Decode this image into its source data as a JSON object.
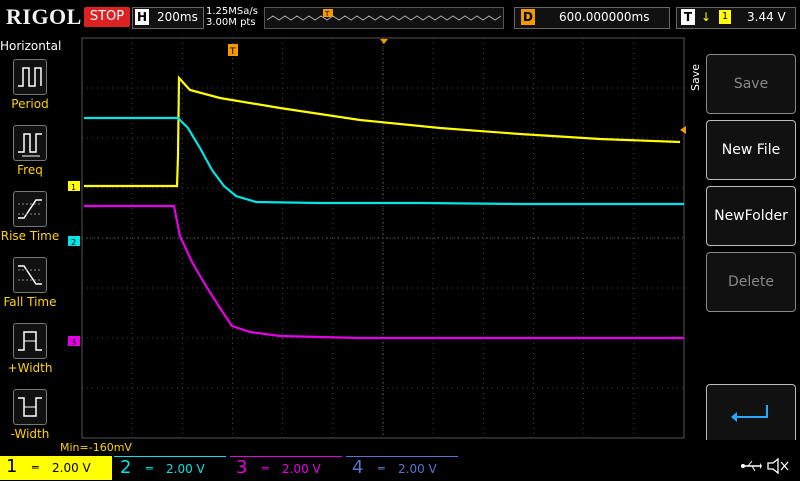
{
  "top": {
    "brand": "RIGOL",
    "run_state": "STOP",
    "timebase_label": "H",
    "timebase": "200ms",
    "sample_rate": "1.25MSa/s",
    "mem_depth": "3.00M pts",
    "delay_label": "D",
    "delay": "600.000000ms",
    "trig_label": "T",
    "trig_source": "1",
    "trig_level": "3.44 V"
  },
  "left_menu": {
    "title": "Horizontal",
    "items": [
      {
        "label": "Period",
        "icon": "period-icon"
      },
      {
        "label": "Freq",
        "icon": "freq-icon"
      },
      {
        "label": "Rise Time",
        "icon": "rise-time-icon"
      },
      {
        "label": "Fall Time",
        "icon": "fall-time-icon"
      },
      {
        "label": "+Width",
        "icon": "positive-width-icon"
      },
      {
        "label": "-Width",
        "icon": "negative-width-icon"
      }
    ]
  },
  "right_menu": {
    "tab": "Save",
    "buttons": [
      {
        "label": "Save",
        "enabled": false
      },
      {
        "label": "New File",
        "enabled": true
      },
      {
        "label": "NewFolder",
        "enabled": true
      },
      {
        "label": "Delete",
        "enabled": false
      },
      {
        "label": "",
        "enabled": true,
        "icon": "enter-arrow-icon"
      }
    ]
  },
  "measure": {
    "min": "Min=-160mV"
  },
  "channels": [
    {
      "num": "1",
      "scale": "2.00 V",
      "color": "#ffff00",
      "active": true
    },
    {
      "num": "2",
      "scale": "2.00 V",
      "color": "#00e5e5",
      "active": false
    },
    {
      "num": "3",
      "scale": "2.00 V",
      "color": "#e600e6",
      "active": false
    },
    {
      "num": "4",
      "scale": "2.00 V",
      "color": "#5577cc",
      "active": false
    }
  ],
  "trigger_marker": "T",
  "colors": {
    "ch1": "#ffff00",
    "ch2": "#00e5e5",
    "ch3": "#e600e6",
    "ch4": "#5577cc",
    "accent": "#f39a00",
    "stop": "#dd2222"
  }
}
